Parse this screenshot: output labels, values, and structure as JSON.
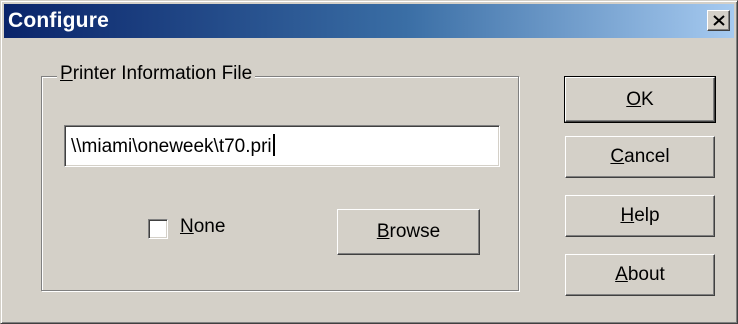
{
  "window": {
    "title": "Configure",
    "close_icon": "close-icon"
  },
  "group": {
    "label_mnemonic": "P",
    "label_rest": "rinter Information File"
  },
  "file_field": {
    "value": "\\\\miami\\oneweek\\t70.pri"
  },
  "none_checkbox": {
    "checked": false,
    "label_mnemonic": "N",
    "label_rest": "one"
  },
  "buttons": {
    "browse": {
      "mnemonic": "B",
      "rest": "rowse"
    },
    "ok": {
      "mnemonic": "O",
      "rest": "K"
    },
    "cancel": {
      "mnemonic": "C",
      "rest": "ancel"
    },
    "help": {
      "mnemonic": "H",
      "rest": "elp"
    },
    "about": {
      "mnemonic": "A",
      "rest": "bout"
    }
  },
  "colors": {
    "face": "#d4d0c8",
    "title_start": "#0a246a",
    "title_end": "#a6caf0"
  }
}
